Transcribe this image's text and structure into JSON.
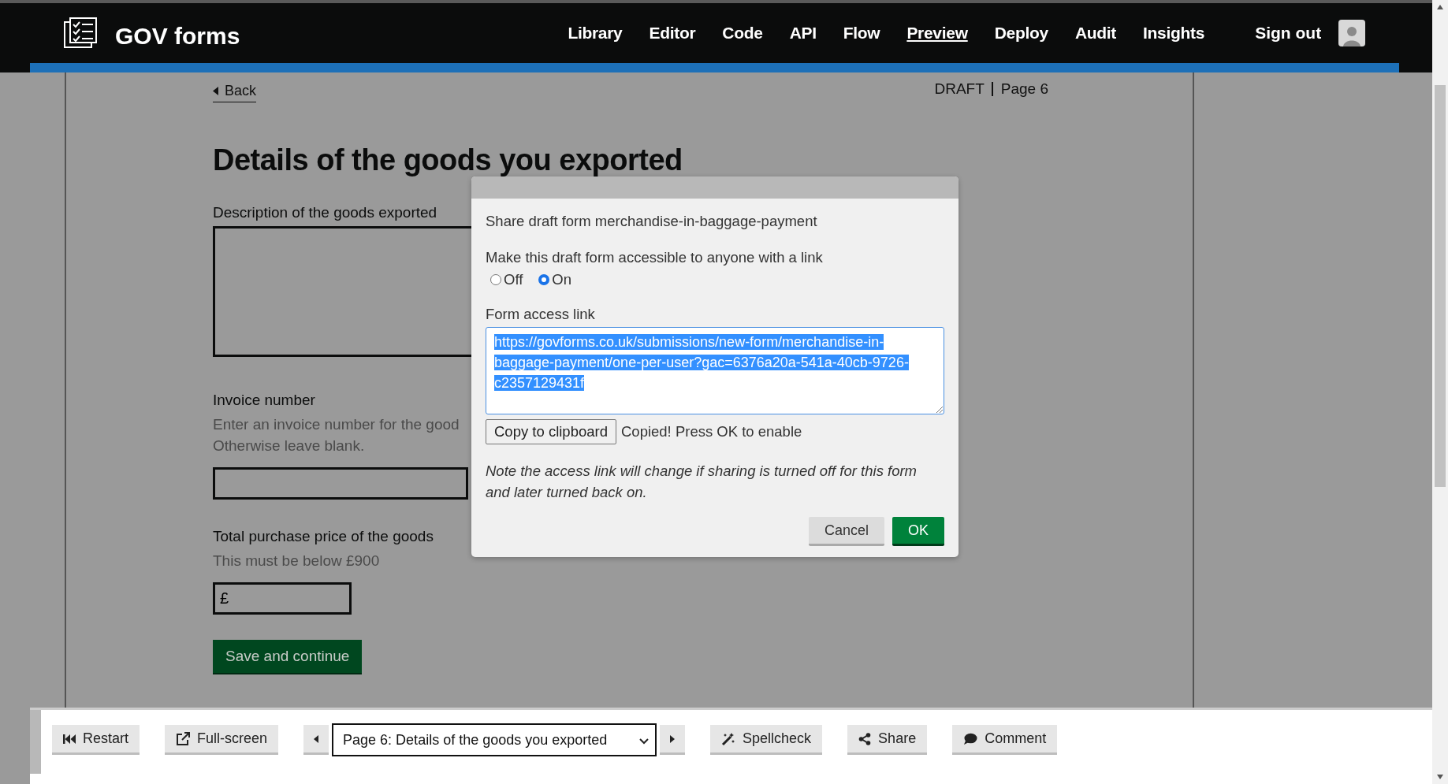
{
  "header": {
    "logo_text": "GOV forms",
    "nav": [
      {
        "label": "Library",
        "selected": false
      },
      {
        "label": "Editor",
        "selected": false
      },
      {
        "label": "Code",
        "selected": false
      },
      {
        "label": "API",
        "selected": false
      },
      {
        "label": "Flow",
        "selected": false
      },
      {
        "label": "Preview",
        "selected": true
      },
      {
        "label": "Deploy",
        "selected": false
      },
      {
        "label": "Audit",
        "selected": false
      },
      {
        "label": "Insights",
        "selected": false
      }
    ],
    "sign_out": "Sign out"
  },
  "page": {
    "back": "Back",
    "status": "DRAFT",
    "page_label": "Page 6",
    "heading": "Details of the goods you exported",
    "fields": [
      {
        "kind": "textarea",
        "label": "Description of the goods exported"
      },
      {
        "kind": "text",
        "label": "Invoice number",
        "hint_lines": [
          "Enter an invoice number for the good",
          "Otherwise leave blank."
        ]
      },
      {
        "kind": "price",
        "label": "Total purchase price of the goods",
        "hint_lines": [
          "This must be below £900"
        ],
        "value": "£"
      }
    ],
    "submit": "Save and continue"
  },
  "dialog": {
    "title": "Share draft form merchandise-in-baggage-payment",
    "question": "Make this draft form accessible to anyone with a link",
    "options": [
      {
        "label": "Off",
        "selected": false
      },
      {
        "label": "On",
        "selected": true
      }
    ],
    "link_label": "Form access link",
    "link": "https://govforms.co.uk/submissions/new-form/merchandise-in-baggage-payment/one-per-user?gac=6376a20a-541a-40cb-9726-c2357129431f",
    "link_selected": true,
    "copy_button": "Copy to clipboard",
    "copy_status": "Copied! Press OK to enable",
    "note": "Note the access link will change if sharing is turned off for this form and later turned back on.",
    "buttons": [
      {
        "kind": "secondary",
        "label": "Cancel"
      },
      {
        "kind": "primary",
        "label": "OK"
      }
    ]
  },
  "toolbar": [
    {
      "kind": "restart",
      "label": "Restart"
    },
    {
      "kind": "fullscreen",
      "label": "Full-screen"
    },
    {
      "kind": "prev"
    },
    {
      "kind": "select",
      "value": "Page 6: Details of the goods you exported"
    },
    {
      "kind": "next"
    },
    {
      "kind": "spellcheck",
      "label": "Spellcheck"
    },
    {
      "kind": "share",
      "label": "Share"
    },
    {
      "kind": "comment",
      "label": "Comment"
    }
  ]
}
